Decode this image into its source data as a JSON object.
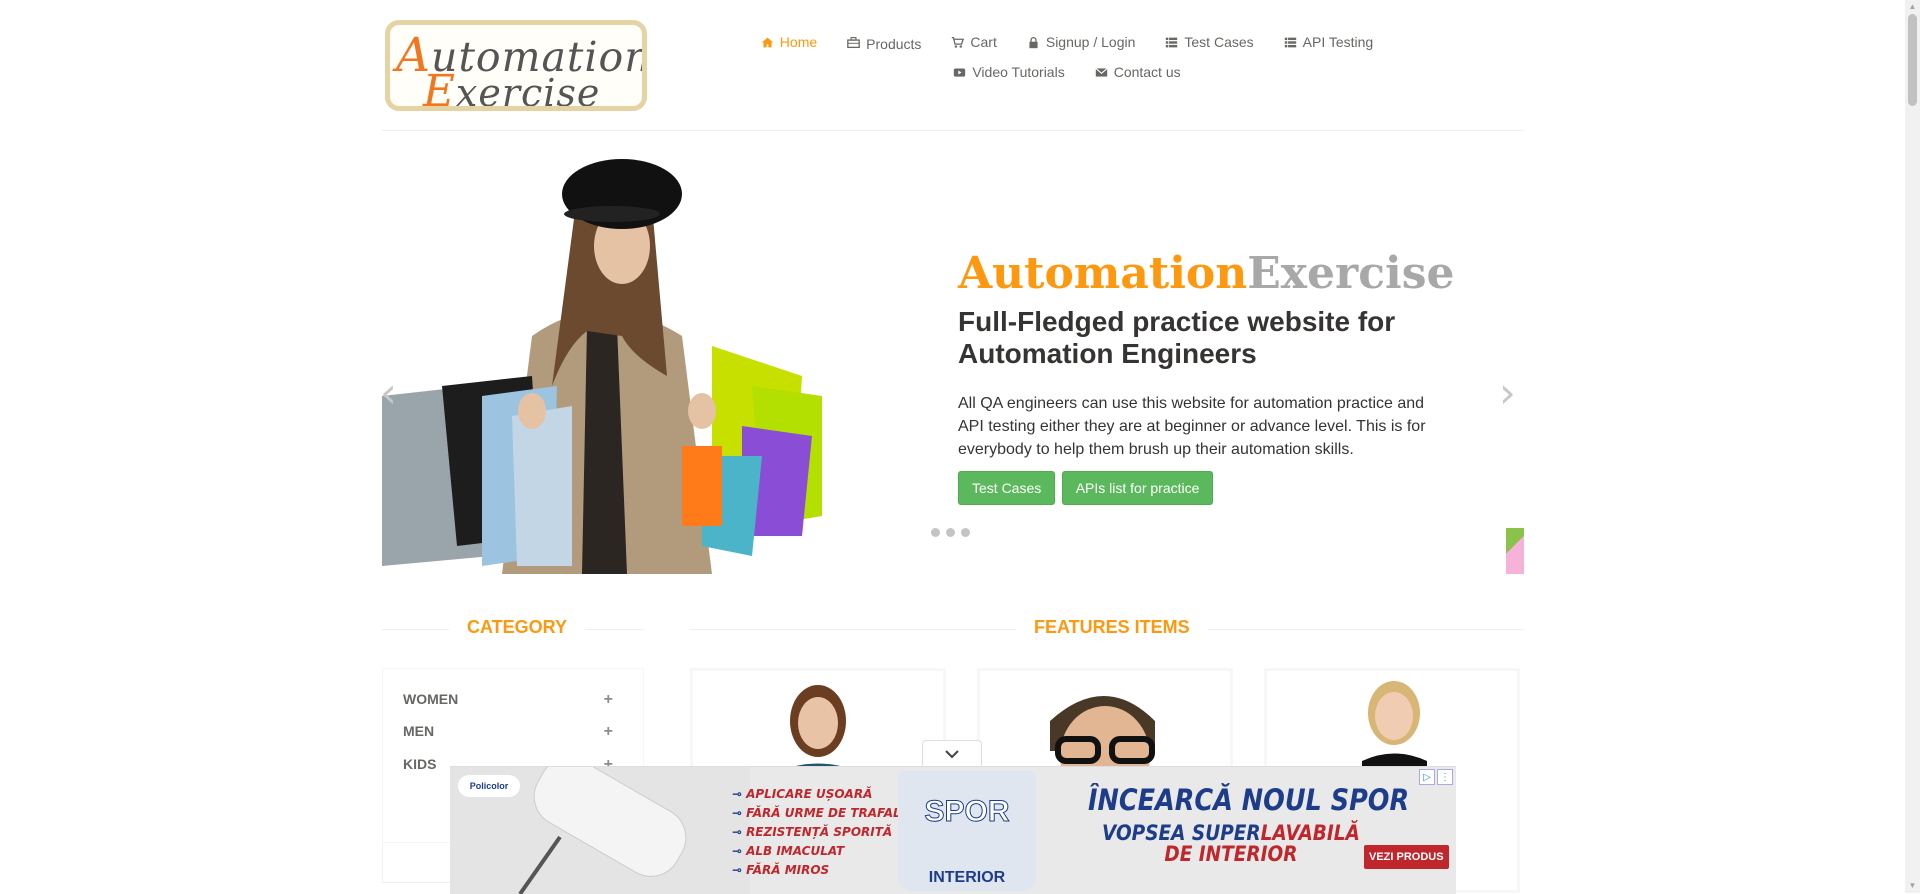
{
  "logo": {
    "line1": "utomation",
    "cap1": "A",
    "line2": "xercise",
    "cap2": "E"
  },
  "nav": {
    "row1": [
      {
        "label": "Home",
        "icon": "home-icon",
        "active": true
      },
      {
        "label": "Products",
        "icon": "briefcase-icon"
      },
      {
        "label": "Cart",
        "icon": "cart-icon"
      },
      {
        "label": "Signup / Login",
        "icon": "lock-icon"
      },
      {
        "label": "Test Cases",
        "icon": "list-icon"
      },
      {
        "label": "API Testing",
        "icon": "list-icon"
      }
    ],
    "row2": [
      {
        "label": "Video Tutorials",
        "icon": "youtube-icon"
      },
      {
        "label": "Contact us",
        "icon": "envelope-icon"
      }
    ]
  },
  "hero": {
    "brand_a": "Automation",
    "brand_b": "Exercise",
    "subtitle": "Full-Fledged practice website for Automation Engineers",
    "text": "All QA engineers can use this website for automation practice and API testing either they are at beginner or advance level. This is for everybody to help them brush up their automation skills.",
    "btn_test_cases": "Test Cases",
    "btn_apis": "APIs list for practice",
    "prev_arrow": "‹",
    "next_arrow": "›",
    "slides_count": 3
  },
  "sidebar": {
    "title": "CATEGORY",
    "items": [
      {
        "label": "WOMEN",
        "toggle": "+"
      },
      {
        "label": "MEN",
        "toggle": "+"
      },
      {
        "label": "KIDS",
        "toggle": "+"
      }
    ]
  },
  "features": {
    "title": "FEATURES ITEMS"
  },
  "ad": {
    "brand": "Policolor",
    "bullets": [
      "APLICARE UȘOARĂ",
      "FĂRĂ URME DE TRAFALET",
      "REZISTENȚĂ SPORITĂ",
      "ALB IMACULAT",
      "FĂRĂ MIROS"
    ],
    "bucket_brand": "SPOR",
    "bucket_sub": "INTERIOR",
    "headline": "ÎNCEARCĂ NOUL SPOR",
    "sub_a": "VOPSEA SUPER",
    "sub_b": "LAVABILĂ",
    "sub_c": "DE INTERIOR",
    "cta": "VEZI PRODUS",
    "colors": {
      "red": "#c0272d",
      "blue": "#1d3c8a"
    }
  },
  "colors": {
    "accent": "#fe980f",
    "button": "#5cb85c",
    "text": "#696763"
  }
}
